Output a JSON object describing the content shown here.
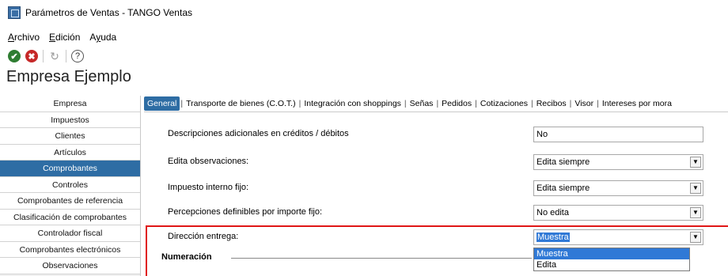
{
  "window": {
    "title": "Parámetros de Ventas - TANGO Ventas"
  },
  "menu": [
    {
      "pre": "",
      "u": "A",
      "post": "rchivo"
    },
    {
      "pre": "",
      "u": "E",
      "post": "dición"
    },
    {
      "pre": "A",
      "u": "y",
      "post": "uda"
    }
  ],
  "toolbar": {
    "ok": "✔",
    "cancel": "✖",
    "refresh": "↻",
    "help": "?"
  },
  "company": "Empresa Ejemplo",
  "sidebar": {
    "items": [
      "Empresa",
      "Impuestos",
      "Clientes",
      "Artículos",
      "Comprobantes",
      "Controles",
      "Comprobantes de referencia",
      "Clasificación de comprobantes",
      "Controlador fiscal",
      "Comprobantes electrónicos",
      "Observaciones"
    ],
    "active_index": 4
  },
  "tabs": {
    "items": [
      "General",
      "Transporte de bienes (C.O.T.)",
      "Integración con shoppings",
      "Señas",
      "Pedidos",
      "Cotizaciones",
      "Recibos",
      "Visor",
      "Intereses por mora"
    ],
    "active_index": 0
  },
  "form": {
    "rows": [
      {
        "label": "Descripciones adicionales en créditos / débitos",
        "value": "No",
        "combo": false
      },
      {
        "label": "Edita observaciones:",
        "value": "Edita siempre",
        "combo": true
      },
      {
        "label": "Impuesto interno fijo:",
        "value": "Edita siempre",
        "combo": true
      },
      {
        "label": "Percepciones definibles por importe fijo:",
        "value": "No edita",
        "combo": true
      },
      {
        "label": "Dirección entrega:",
        "value": "Muestra",
        "combo": true,
        "selected": true
      }
    ]
  },
  "dropdown": {
    "options": [
      "Muestra",
      "Edita"
    ],
    "highlighted_index": 0
  },
  "section": {
    "title": "Numeración"
  },
  "colors": {
    "accent": "#2e6da4",
    "highlight": "#e01616"
  }
}
